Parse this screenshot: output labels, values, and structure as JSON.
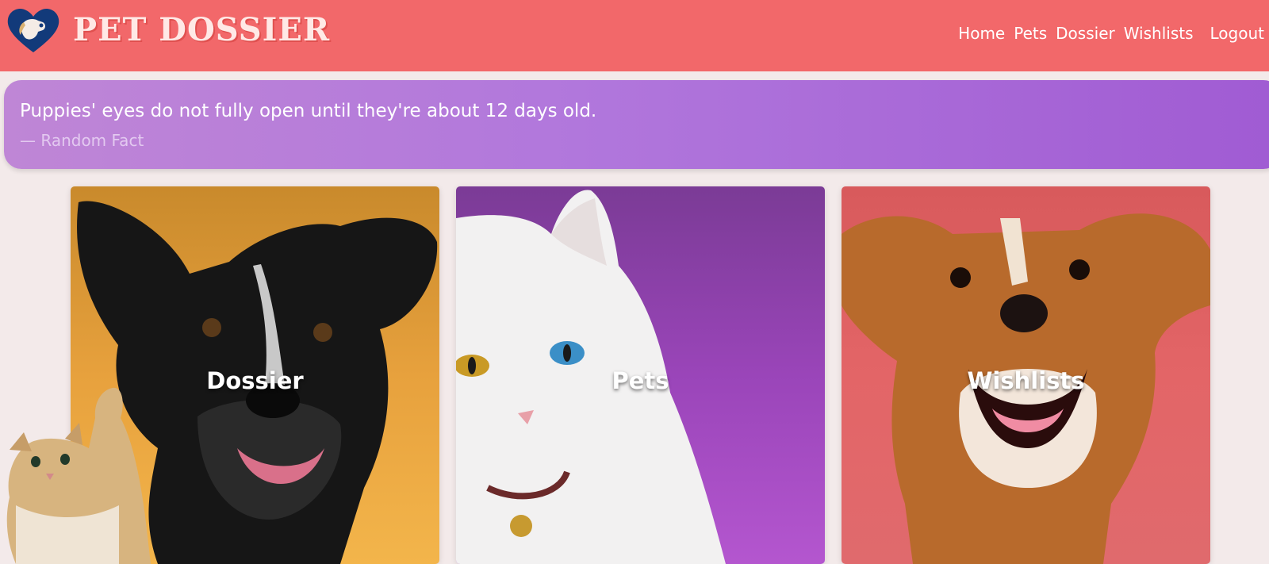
{
  "header": {
    "brand": "PET DOSSIER",
    "logo_icon": "heart-dog-logo-icon",
    "nav": [
      {
        "label": "Home"
      },
      {
        "label": "Pets"
      },
      {
        "label": "Dossier"
      },
      {
        "label": "Wishlists"
      },
      {
        "label": "Logout"
      }
    ]
  },
  "fact": {
    "text": "Puppies' eyes do not fully open until they're about 12 days old.",
    "source": "— Random Fact"
  },
  "cards": [
    {
      "label": "Dossier",
      "image": "black-and-white-dog-photo"
    },
    {
      "label": "Pets",
      "image": "white-cat-photo"
    },
    {
      "label": "Wishlists",
      "image": "brown-puppy-photo"
    }
  ],
  "decor": {
    "corner_image": "waving-kitten"
  },
  "colors": {
    "header": "#f2686a",
    "background": "#f3eaea",
    "fact_gradient_start": "#bf86d6",
    "fact_gradient_end": "#a05bd3",
    "logo_heart": "#123a7a"
  }
}
